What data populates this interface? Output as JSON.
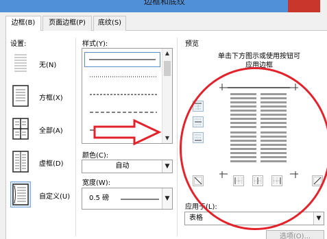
{
  "window": {
    "title": "边框和底纹"
  },
  "tabs": [
    {
      "label": "边框(B)"
    },
    {
      "label": "页面边框(P)"
    },
    {
      "label": "底纹(S)"
    }
  ],
  "settings": {
    "label": "设置:",
    "items": [
      {
        "label": "无(N)"
      },
      {
        "label": "方框(X)"
      },
      {
        "label": "全部(A)"
      },
      {
        "label": "虚框(D)"
      },
      {
        "label": "自定义(U)"
      }
    ],
    "selected": "自定义(U)"
  },
  "style": {
    "label": "样式(Y):",
    "line_styles": [
      "solid",
      "dotted",
      "dashed-short",
      "dashed",
      "dash-dot"
    ],
    "selected_index": 0
  },
  "color": {
    "label": "颜色(C):",
    "value": "自动"
  },
  "width": {
    "label": "宽度(W):",
    "value": "0.5 磅"
  },
  "preview": {
    "label": "预览",
    "instruction_line1": "单击下方图示或使用按钮可",
    "instruction_line2": "应用边框"
  },
  "apply_to": {
    "label": "应用于(L):",
    "value": "表格"
  },
  "options_button": {
    "label": "选项(O)..."
  },
  "colors": {
    "annotation_red": "#e3232b",
    "selection_blue": "#dbe8f7"
  }
}
